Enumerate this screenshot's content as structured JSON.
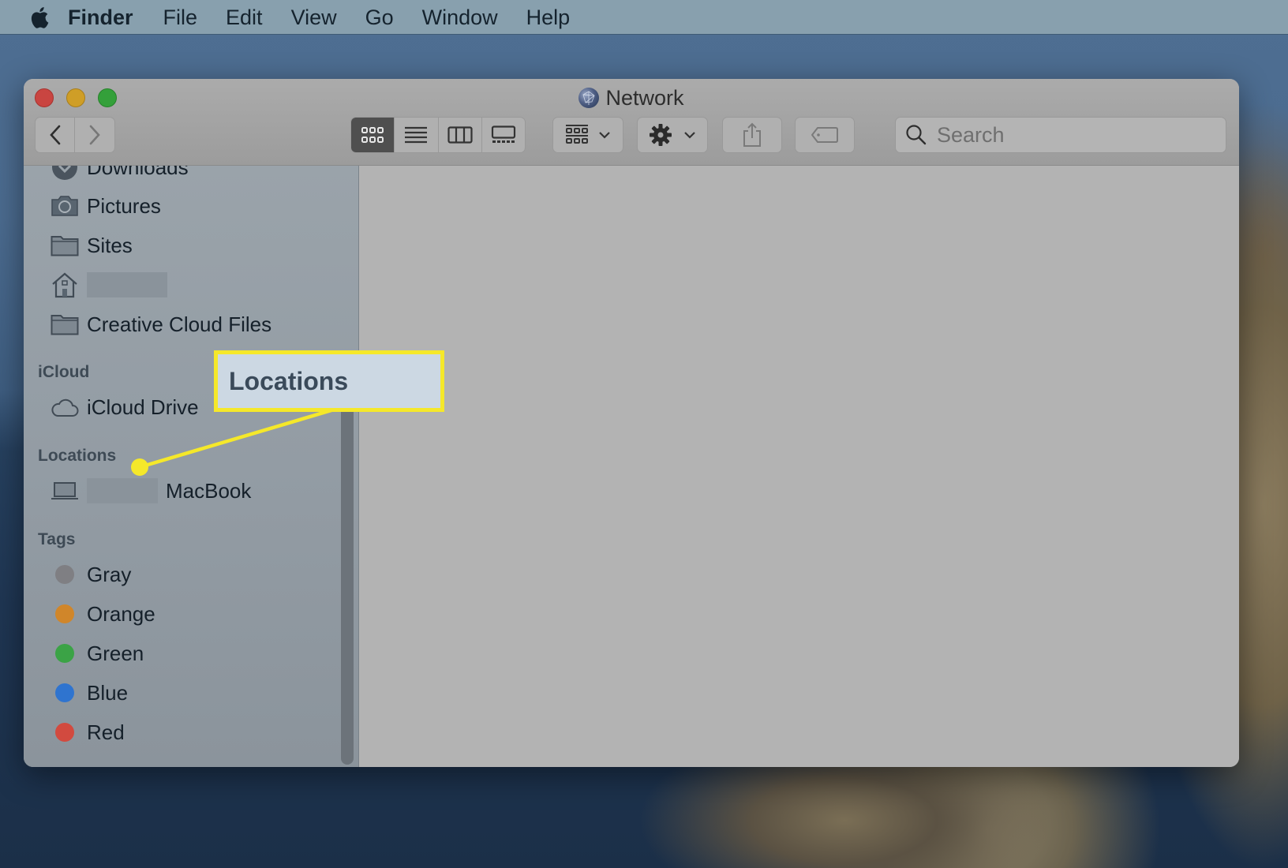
{
  "menubar": {
    "apple_icon": "apple-logo-icon",
    "app_name": "Finder",
    "items": [
      "File",
      "Edit",
      "View",
      "Go",
      "Window",
      "Help"
    ]
  },
  "window": {
    "title": "Network",
    "title_icon": "network-globe-icon",
    "traffic_lights": {
      "close": "#c94541",
      "minimize": "#cf9e27",
      "maximize": "#34a03a"
    },
    "toolbar": {
      "back_icon": "chevron-left-icon",
      "forward_icon": "chevron-right-icon",
      "views": [
        {
          "name": "icon-view",
          "active": true
        },
        {
          "name": "list-view",
          "active": false
        },
        {
          "name": "column-view",
          "active": false
        },
        {
          "name": "gallery-view",
          "active": false
        }
      ],
      "group_icon": "group-by-icon",
      "action_icon": "gear-icon",
      "share_icon": "share-icon",
      "tag_icon": "tag-icon",
      "search_placeholder": "Search"
    }
  },
  "sidebar": {
    "favorites": [
      {
        "label": "Downloads",
        "icon": "downloads-icon"
      },
      {
        "label": "Pictures",
        "icon": "camera-icon"
      },
      {
        "label": "Sites",
        "icon": "folder-icon"
      },
      {
        "label": "",
        "icon": "home-icon",
        "redacted": true
      },
      {
        "label": "Creative Cloud Files",
        "icon": "folder-icon"
      }
    ],
    "icloud_header": "iCloud",
    "icloud": [
      {
        "label": "iCloud Drive",
        "icon": "cloud-icon"
      }
    ],
    "locations_header": "Locations",
    "locations": [
      {
        "label": "MacBook",
        "icon": "laptop-icon",
        "redacted_prefix": true
      }
    ],
    "tags_header": "Tags",
    "tags": [
      {
        "label": "Gray",
        "color": "#7f7f83"
      },
      {
        "label": "Orange",
        "color": "#d0862a"
      },
      {
        "label": "Green",
        "color": "#3ba346"
      },
      {
        "label": "Blue",
        "color": "#2f74cf"
      },
      {
        "label": "Red",
        "color": "#d24a3f"
      }
    ]
  },
  "annotation": {
    "label": "Locations",
    "color": "#f5e82a"
  }
}
